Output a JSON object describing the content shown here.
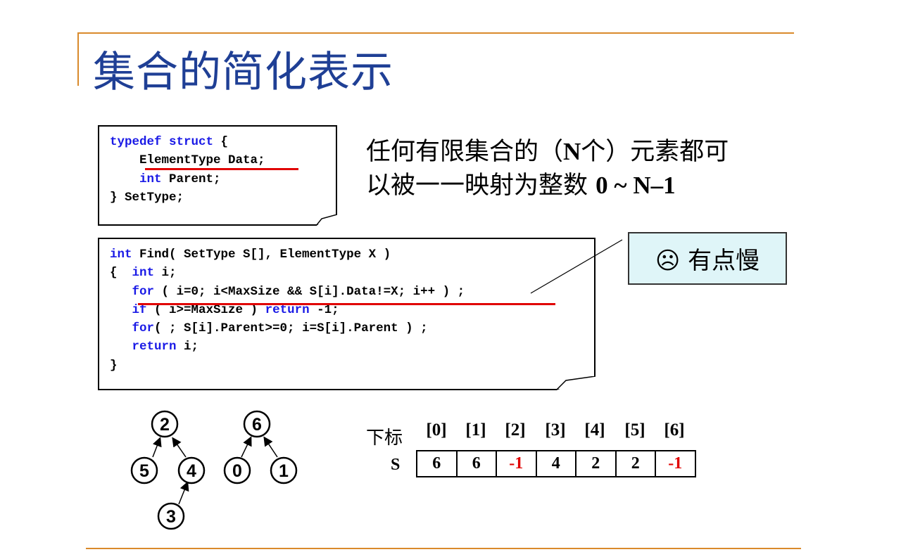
{
  "title": "集合的简化表示",
  "struct_code": {
    "line1_kw": "typedef struct",
    "line1_rest": " {",
    "line2": "ElementType Data;",
    "line3_kw": "int",
    "line3_rest": " Parent;",
    "line4": "} SetType;"
  },
  "find_code": {
    "l1_kw": "int",
    "l1_rest": " Find( SetType S[], ElementType X )",
    "l2_open": "{  ",
    "l2_kw": "int",
    "l2_rest": " i;",
    "l3_kw": "for",
    "l3_rest": " ( i=0; i<MaxSize && S[i].Data!=X; i++ ) ;",
    "l4_kw1": "if",
    "l4_mid": " ( i>=MaxSize ) ",
    "l4_kw2": "return",
    "l4_rest": " -1;",
    "l5_kw": "for",
    "l5_rest": "( ; S[i].Parent>=0; i=S[i].Parent ) ;",
    "l6_kw": "return",
    "l6_rest": " i;",
    "l7": "}"
  },
  "description": {
    "line1_a": "任何有限集合的（",
    "line1_n": "N",
    "line1_b": "个）元素都可",
    "line2_a": "以被一一映射为整数 ",
    "line2_range": "0 ~ N–1"
  },
  "callout": "☹ 有点慢",
  "trees": {
    "nodes": [
      "2",
      "5",
      "4",
      "3",
      "6",
      "0",
      "1"
    ]
  },
  "array": {
    "index_label": "下标",
    "row_label": "S",
    "indices": [
      "[0]",
      "[1]",
      "[2]",
      "[3]",
      "[4]",
      "[5]",
      "[6]"
    ],
    "values": [
      "6",
      "6",
      "-1",
      "4",
      "2",
      "2",
      "-1"
    ],
    "root_value_color": "#e00000"
  },
  "colors": {
    "title": "#1f3f95",
    "keyword": "#1a1ae6",
    "rule": "#d98a2b",
    "callout_bg": "#dff5f8",
    "underline": "#e00000"
  }
}
